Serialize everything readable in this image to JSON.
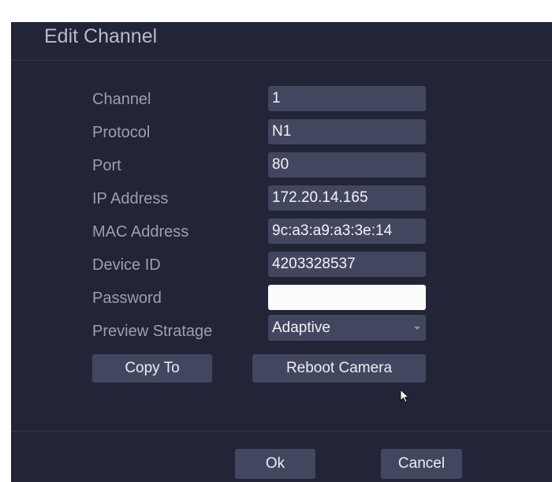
{
  "dialog": {
    "title": "Edit Channel",
    "fields": [
      {
        "label": "Channel",
        "value": "1"
      },
      {
        "label": "Protocol",
        "value": "N1"
      },
      {
        "label": "Port",
        "value": "80"
      },
      {
        "label": "IP Address",
        "value": "172.20.14.165"
      },
      {
        "label": "MAC Address",
        "value": "9c:a3:a9:a3:3e:14"
      },
      {
        "label": "Device ID",
        "value": "4203328537"
      },
      {
        "label": "Password",
        "value": ""
      }
    ],
    "preview": {
      "label": "Preview Stratage",
      "value": "Adaptive",
      "icon": "chevron-down-icon"
    },
    "buttons": {
      "copy_to": "Copy To",
      "reboot_camera": "Reboot Camera",
      "ok": "Ok",
      "cancel": "Cancel"
    },
    "cursor_icon": "mouse-pointer-icon"
  },
  "colors": {
    "background": "#222538",
    "field": "#43465f",
    "label_text": "#9c9fb2",
    "value_text": "#f1f2f7"
  }
}
